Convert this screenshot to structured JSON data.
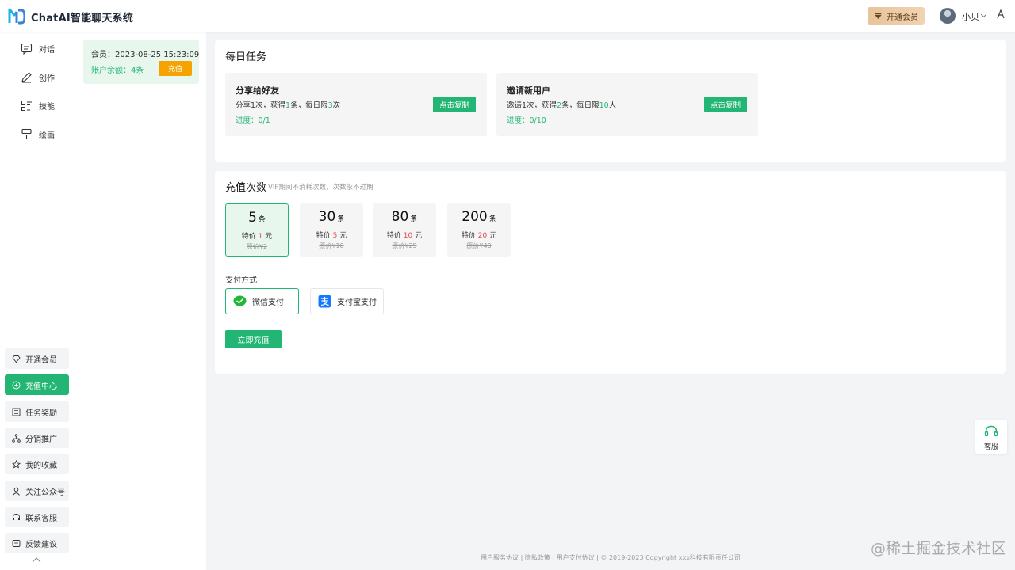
{
  "app": {
    "title": "ChatAI智能聊天系统"
  },
  "header": {
    "vip_button": "开通会员",
    "user_name": "小贝"
  },
  "sidebar": {
    "nav": [
      {
        "label": "对话",
        "icon": "chat-icon"
      },
      {
        "label": "创作",
        "icon": "pen-icon"
      },
      {
        "label": "技能",
        "icon": "skills-icon"
      },
      {
        "label": "绘画",
        "icon": "brush-icon"
      }
    ],
    "menu": [
      {
        "label": "开通会员",
        "icon": "diamond-icon"
      },
      {
        "label": "充值中心",
        "icon": "recharge-icon",
        "active": true
      },
      {
        "label": "任务奖励",
        "icon": "task-icon"
      },
      {
        "label": "分销推广",
        "icon": "share-network-icon"
      },
      {
        "label": "我的收藏",
        "icon": "star-icon"
      },
      {
        "label": "关注公众号",
        "icon": "user-icon"
      },
      {
        "label": "联系客服",
        "icon": "headset-icon"
      },
      {
        "label": "反馈建议",
        "icon": "feedback-icon"
      }
    ]
  },
  "member": {
    "expiry": "会员：2023-08-25 15:23:09",
    "balance": "账户余额：4条",
    "recharge_button": "充值"
  },
  "daily_tasks": {
    "title": "每日任务",
    "tasks": [
      {
        "name": "分享给好友",
        "desc_1": "分享1次，获得",
        "reward": "1",
        "desc_2": "条，每日限",
        "limit": "3",
        "desc_3": "次",
        "progress": "进度：0/1",
        "button": "点击复制"
      },
      {
        "name": "邀请新用户",
        "desc_1": "邀请1次，获得",
        "reward": "2",
        "desc_2": "条，每日限",
        "limit": "10",
        "desc_3": "人",
        "progress": "进度：0/10",
        "button": "点击复制"
      }
    ]
  },
  "recharge": {
    "title": "充值次数",
    "subtitle": "VIP期间不消耗次数，次数永不过期",
    "packages": [
      {
        "count": "5",
        "unit": "条",
        "price_prefix": "特价",
        "price": "1",
        "price_unit": "元",
        "original": "原价¥2",
        "selected": true
      },
      {
        "count": "30",
        "unit": "条",
        "price_prefix": "特价",
        "price": "5",
        "price_unit": "元",
        "original": "原价¥10"
      },
      {
        "count": "80",
        "unit": "条",
        "price_prefix": "特价",
        "price": "10",
        "price_unit": "元",
        "original": "原价¥25"
      },
      {
        "count": "200",
        "unit": "条",
        "price_prefix": "特价",
        "price": "20",
        "price_unit": "元",
        "original": "原价¥40"
      }
    ],
    "payment_label": "支付方式",
    "payment_methods": [
      {
        "label": "微信支付",
        "icon": "wechat-pay-icon",
        "selected": true
      },
      {
        "label": "支付宝支付",
        "icon": "alipay-icon"
      }
    ],
    "submit": "立即充值"
  },
  "service": {
    "label": "客服"
  },
  "footer": {
    "text": "用户服务协议 | 隐私政策 | 用户支付协议 | © 2019-2023 Copyright xxx科技有限责任公司"
  },
  "watermark": "@稀土掘金技术社区",
  "colors": {
    "primary": "#22b573",
    "warning": "#f4a300",
    "price_red": "#e5484d",
    "vip_gold": "#e8c39a"
  }
}
